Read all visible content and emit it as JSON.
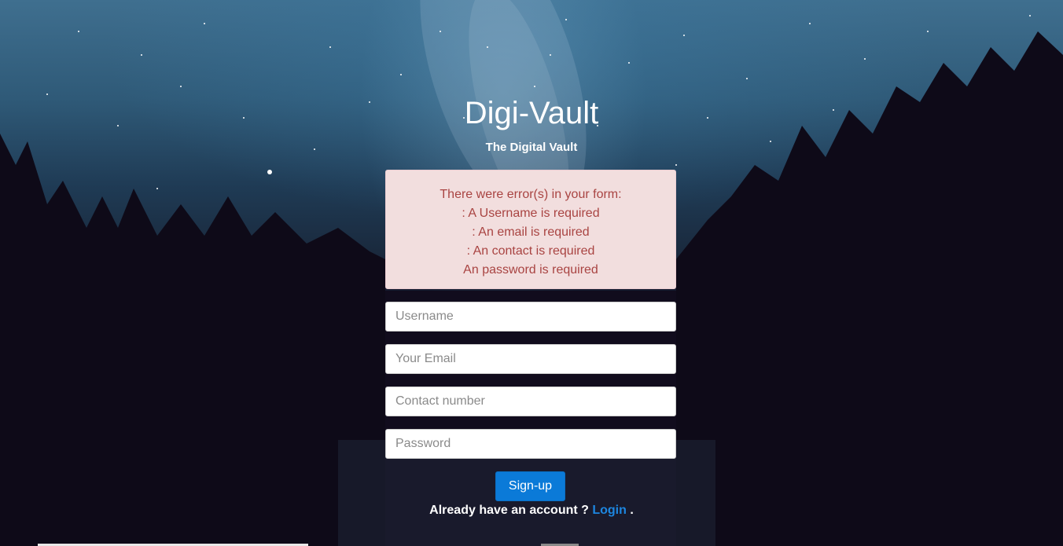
{
  "brand": {
    "title": "Digi-Vault",
    "subtitle": "The Digital Vault"
  },
  "errors": {
    "heading": "There were error(s) in your form:",
    "items": [
      ": A Username is required",
      ": An email is required",
      ": An contact is required",
      "An password is required"
    ]
  },
  "form": {
    "username": {
      "placeholder": "Username",
      "value": ""
    },
    "email": {
      "placeholder": "Your Email",
      "value": ""
    },
    "contact": {
      "placeholder": "Contact number",
      "value": ""
    },
    "password": {
      "placeholder": "Password",
      "value": ""
    },
    "submit_label": "Sign-up"
  },
  "footer": {
    "prompt": "Already have an account ?",
    "login_label": "Login",
    "suffix": "."
  },
  "colors": {
    "accent": "#0b7ad8",
    "error_bg": "#f2dede",
    "error_text": "#a94442"
  }
}
